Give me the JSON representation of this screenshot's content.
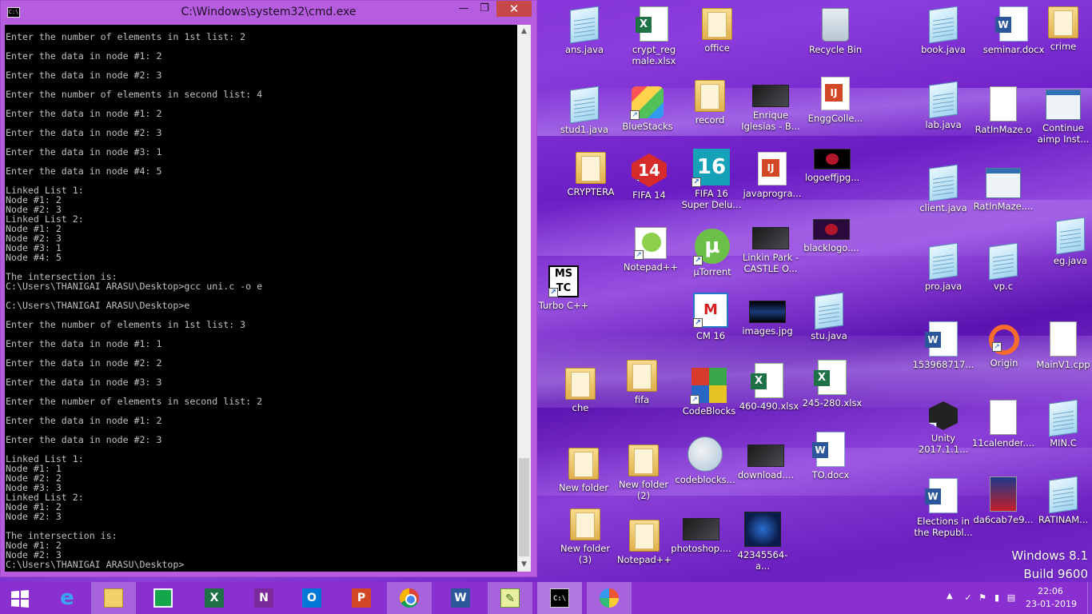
{
  "cmd": {
    "title": "C:\\Windows\\system32\\cmd.exe",
    "icon": "cmd-icon",
    "icon_text": "C:\\",
    "lines": [
      "Enter the number of elements in 1st list: 2",
      "",
      "Enter the data in node #1: 2",
      "",
      "Enter the data in node #2: 3",
      "",
      "Enter the number of elements in second list: 4",
      "",
      "Enter the data in node #1: 2",
      "",
      "Enter the data in node #2: 3",
      "",
      "Enter the data in node #3: 1",
      "",
      "Enter the data in node #4: 5",
      "",
      "Linked List 1:",
      "Node #1: 2",
      "Node #2: 3",
      "Linked List 2:",
      "Node #1: 2",
      "Node #2: 3",
      "Node #3: 1",
      "Node #4: 5",
      "",
      "The intersection is:",
      "C:\\Users\\THANIGAI ARASU\\Desktop>gcc uni.c -o e",
      "",
      "C:\\Users\\THANIGAI ARASU\\Desktop>e",
      "",
      "Enter the number of elements in 1st list: 3",
      "",
      "Enter the data in node #1: 1",
      "",
      "Enter the data in node #2: 2",
      "",
      "Enter the data in node #3: 3",
      "",
      "Enter the number of elements in second list: 2",
      "",
      "Enter the data in node #1: 2",
      "",
      "Enter the data in node #2: 3",
      "",
      "Linked List 1:",
      "Node #1: 1",
      "Node #2: 2",
      "Node #3: 3",
      "Linked List 2:",
      "Node #1: 2",
      "Node #2: 3",
      "",
      "The intersection is:",
      "Node #1: 2",
      "Node #2: 3",
      "C:\\Users\\THANIGAI ARASU\\Desktop>"
    ]
  },
  "desktop": {
    "icons": {
      "ans_java": "ans.java",
      "crypt_reg_male": "crypt_reg\nmale.xlsx",
      "office": "office",
      "recycle_bin": "Recycle Bin",
      "book_java": "book.java",
      "seminar_docx": "seminar.docx",
      "crime": "crime",
      "stud1_java": "stud1.java",
      "bluestacks": "BlueStacks",
      "record": "record",
      "enrique": "Enrique\nIglesias - B...",
      "enggcolle": "EnggColle...",
      "lab_java": "lab.java",
      "ratinmaze_o": "RatInMaze.o",
      "continue_aimp": "Continue\naimp Inst...",
      "cryptera": "CRYPTERA",
      "fifa14": "FIFA 14",
      "fifa16": "FIFA 16\nSuper Delu...",
      "javaprogra": "javaprogra...",
      "logoeffjpg": "logoeffjpg...",
      "client_java": "client.java",
      "ratinmaze2": "RatInMaze....",
      "notepadpp": "Notepad++",
      "utorrent": "µTorrent",
      "linkin_park": "Linkin Park -\nCASTLE O...",
      "blacklogo": "blacklogo....",
      "eg_java": "eg.java",
      "turbo_cpp": "Turbo C++",
      "pro_java": "pro.java",
      "vp_c": "vp.c",
      "cm16": "CM 16",
      "images_jpg": "images.jpg",
      "stu_java": "stu.java",
      "doc153968717": "153968717...",
      "origin": "Origin",
      "mainv1_cpp": "MainV1.cpp",
      "che": "che",
      "fifa": "fifa",
      "codeblocks": "CodeBlocks",
      "xlsx460": "460-490.xlsx",
      "xlsx245": "245-280.xlsx",
      "unity": "Unity\n2017.1.1...",
      "calender11": "11calender....",
      "min_c": "MIN.C",
      "new_folder": "New folder",
      "new_folder_2": "New folder\n(2)",
      "codeblocks2": "codeblocks...",
      "download": "download....",
      "to_docx": "TO.docx",
      "elections": "Elections in\nthe Republ...",
      "da6cab7e9": "da6cab7e9...",
      "ratinam": "RATINAM...",
      "new_folder_3": "New folder\n(3)",
      "notepadpp2": "Notepad++",
      "photoshop": "photoshop....",
      "img42345564": "42345564-a..."
    },
    "watermark": {
      "line1": "Windows 8.1",
      "line2": "Build 9600"
    }
  },
  "taskbar": {
    "apps": [
      "start-icon",
      "internet-explorer-icon",
      "file-explorer-icon",
      "store-icon",
      "excel-icon",
      "onenote-icon",
      "outlook-icon",
      "powerpoint-icon",
      "chrome-icon",
      "word-icon",
      "notepadpp-icon",
      "cmd-icon",
      "paint-icon"
    ],
    "glyphs": {
      "ie": "e",
      "excel": "X",
      "onenote": "N",
      "outlook": "O",
      "ppt": "P",
      "word": "W",
      "cmd": "C:\\"
    },
    "tray": {
      "time": "22:06",
      "date": "23-01-2019"
    }
  }
}
